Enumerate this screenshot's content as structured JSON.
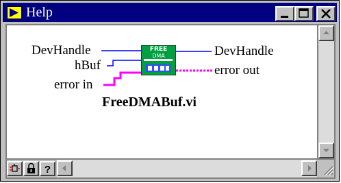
{
  "window": {
    "title": "Help",
    "controls": [
      "minimize-icon",
      "maximize-icon",
      "close-icon"
    ]
  },
  "vi": {
    "name": "FreeDMABuf.vi",
    "icon_line1": "FREE",
    "icon_line2": "DMA",
    "inputs": [
      "DevHandle",
      "hBuf",
      "error in"
    ],
    "outputs": [
      "DevHandle",
      "error out"
    ]
  },
  "toolbar": {
    "buttons": [
      "simple-diagram-help-icon",
      "lock-icon",
      "question-icon"
    ]
  },
  "colors": {
    "titlebar": "#000080",
    "wire_numeric": "#0000ff",
    "wire_error": "#ff00ff",
    "icon_bg": "#00a040"
  }
}
